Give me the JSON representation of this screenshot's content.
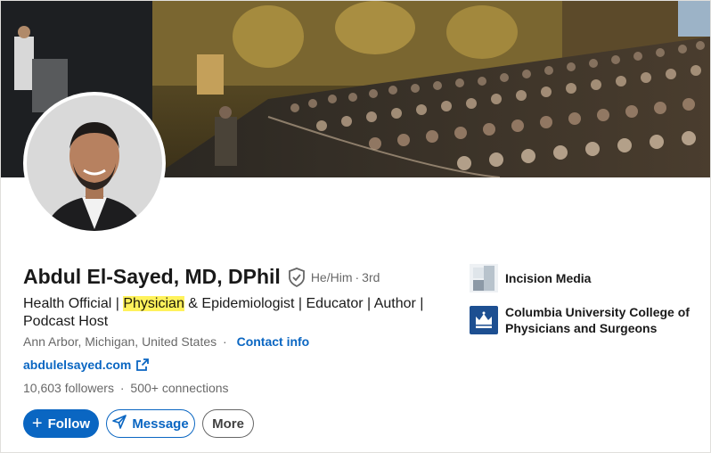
{
  "profile": {
    "name": "Abdul El-Sayed, MD, DPhil",
    "pronouns": "He/Him",
    "degree": "3rd",
    "dot": "·",
    "headline_pre": "Health Official | ",
    "headline_highlight": "Physician",
    "headline_post": " & Epidemiologist | Educator | Author | Podcast Host",
    "location": "Ann Arbor, Michigan, United States",
    "location_sep": "·",
    "contact_label": "Contact info",
    "website": "abdulelsayed.com",
    "followers": "10,603 followers",
    "connections": "500+ connections",
    "stats_sep": "·"
  },
  "actions": {
    "follow_label": "Follow",
    "follow_icon": "+",
    "message_label": "Message",
    "more_label": "More"
  },
  "affiliations": [
    {
      "label": "Incision Media",
      "icon": "incision-media-logo"
    },
    {
      "label": "Columbia University College of Physicians and Surgeons",
      "icon": "columbia-crown-logo"
    }
  ],
  "colors": {
    "accent": "#0a66c2",
    "highlight": "#fff25c",
    "columbia": "#1d4f91"
  }
}
